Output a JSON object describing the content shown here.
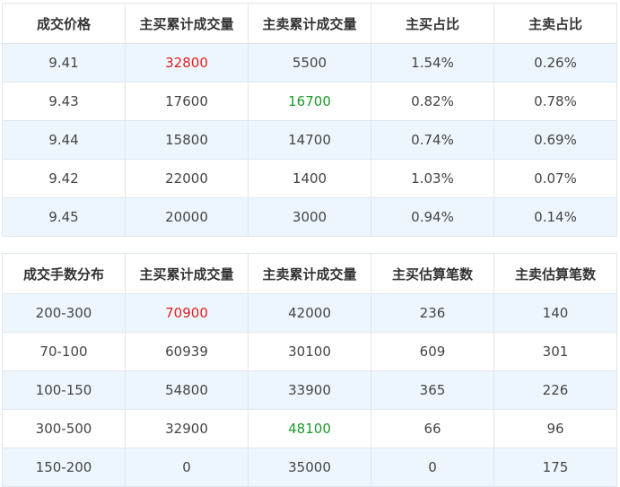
{
  "price_table": {
    "headers": [
      "成交价格",
      "主买累计成交量",
      "主卖累计成交量",
      "主买占比",
      "主卖占比"
    ],
    "rows": [
      [
        "9.41",
        "32800",
        "5500",
        "1.54%",
        "0.26%"
      ],
      [
        "9.43",
        "17600",
        "16700",
        "0.82%",
        "0.78%"
      ],
      [
        "9.44",
        "15800",
        "14700",
        "0.74%",
        "0.69%"
      ],
      [
        "9.42",
        "22000",
        "1400",
        "1.03%",
        "0.07%"
      ],
      [
        "9.45",
        "20000",
        "3000",
        "0.94%",
        "0.14%"
      ]
    ],
    "highlights": {
      "max_buy": "32800",
      "max_sell": "16700"
    }
  },
  "lot_table": {
    "headers": [
      "成交手数分布",
      "主买累计成交量",
      "主卖累计成交量",
      "主买估算笔数",
      "主卖估算笔数"
    ],
    "rows": [
      [
        "200-300",
        "70900",
        "42000",
        "236",
        "140"
      ],
      [
        "70-100",
        "60939",
        "30100",
        "609",
        "301"
      ],
      [
        "100-150",
        "54800",
        "33900",
        "365",
        "226"
      ],
      [
        "300-500",
        "32900",
        "48100",
        "66",
        "96"
      ],
      [
        "150-200",
        "0",
        "35000",
        "0",
        "175"
      ]
    ],
    "highlights": {
      "max_buy": "70900",
      "max_sell": "48100"
    }
  },
  "colors": {
    "buy_highlight": "#e02020",
    "sell_highlight": "#1a9a2a",
    "row_stripe": "#eef6fd",
    "border": "#dfe6ee"
  }
}
